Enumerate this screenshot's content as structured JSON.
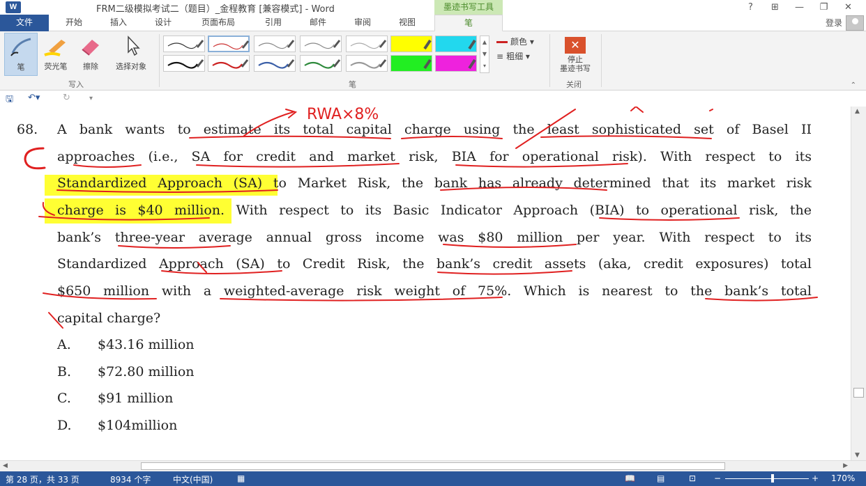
{
  "window": {
    "app_logo": "W",
    "title": "FRM二级模拟考试二（题目）_金程教育 [兼容模式] - Word",
    "contextual_tab_group": "墨迹书写工具",
    "help": "?",
    "ribbon_display": "⊞",
    "minimize": "—",
    "restore": "❐",
    "close": "✕"
  },
  "tabs": [
    {
      "label": "文件"
    },
    {
      "label": "开始"
    },
    {
      "label": "插入"
    },
    {
      "label": "设计"
    },
    {
      "label": "页面布局"
    },
    {
      "label": "引用"
    },
    {
      "label": "邮件"
    },
    {
      "label": "审阅"
    },
    {
      "label": "视图"
    },
    {
      "label": "笔"
    }
  ],
  "account": {
    "login": "登录"
  },
  "ribbon": {
    "write_group": {
      "label": "写入",
      "pen": "笔",
      "highlighter": "荧光笔",
      "eraser": "擦除",
      "select_objects": "选择对象"
    },
    "pens_group": {
      "label": "笔",
      "color": "颜色",
      "thickness": "粗细",
      "pens": [
        {
          "color": "#333333",
          "type": "pen"
        },
        {
          "color": "#cc3333",
          "type": "pen"
        },
        {
          "color": "#888888",
          "type": "pen"
        },
        {
          "color": "#888888",
          "type": "pen"
        },
        {
          "color": "#aaaaaa",
          "type": "pen"
        },
        {
          "color": "#ffff00",
          "type": "highlighter"
        },
        {
          "color": "#22d8ee",
          "type": "highlighter"
        },
        {
          "color": "#111111",
          "type": "pen"
        },
        {
          "color": "#cc2222",
          "type": "pen"
        },
        {
          "color": "#3a5fa8",
          "type": "pen"
        },
        {
          "color": "#2e8a3c",
          "type": "pen"
        },
        {
          "color": "#999999",
          "type": "pen"
        },
        {
          "color": "#22ee22",
          "type": "highlighter"
        },
        {
          "color": "#ee22dd",
          "type": "highlighter"
        }
      ]
    },
    "close_group": {
      "label": "关闭",
      "stop_line1": "停止",
      "stop_line2": "墨迹书写"
    }
  },
  "document": {
    "question_number": "68.",
    "lines": [
      "A bank wants to estimate its total capital charge using the least sophisticated set of Basel II",
      "approaches (i.e., SA for credit and market risk, BIA for operational risk). With respect to its",
      "Standardized Approach (SA) to Market Risk, the bank has already determined that its market risk",
      "charge is $40 million. With respect to its Basic Indicator Approach (BIA) to operational risk, the",
      "bank’s three-year average annual gross income was $80 million per year. With respect to its",
      "Standardized Approach (SA) to Credit Risk, the bank’s credit assets (aka, credit exposures) total",
      "$650 million with a weighted-average risk weight of 75%. Which is nearest to the bank’s total",
      "capital charge?"
    ],
    "options": [
      {
        "letter": "A.",
        "text": "$43.16 million"
      },
      {
        "letter": "B.",
        "text": "$72.80 million"
      },
      {
        "letter": "C.",
        "text": "$91 million"
      },
      {
        "letter": "D.",
        "text": "$104million"
      }
    ],
    "ink_annotations": {
      "top_note": "RWA×8%",
      "answer_mark": "C"
    }
  },
  "status_bar": {
    "page": "第 28 页，共 33 页",
    "words": "8934 个字",
    "language": "中文(中国)",
    "zoom": "170%"
  }
}
